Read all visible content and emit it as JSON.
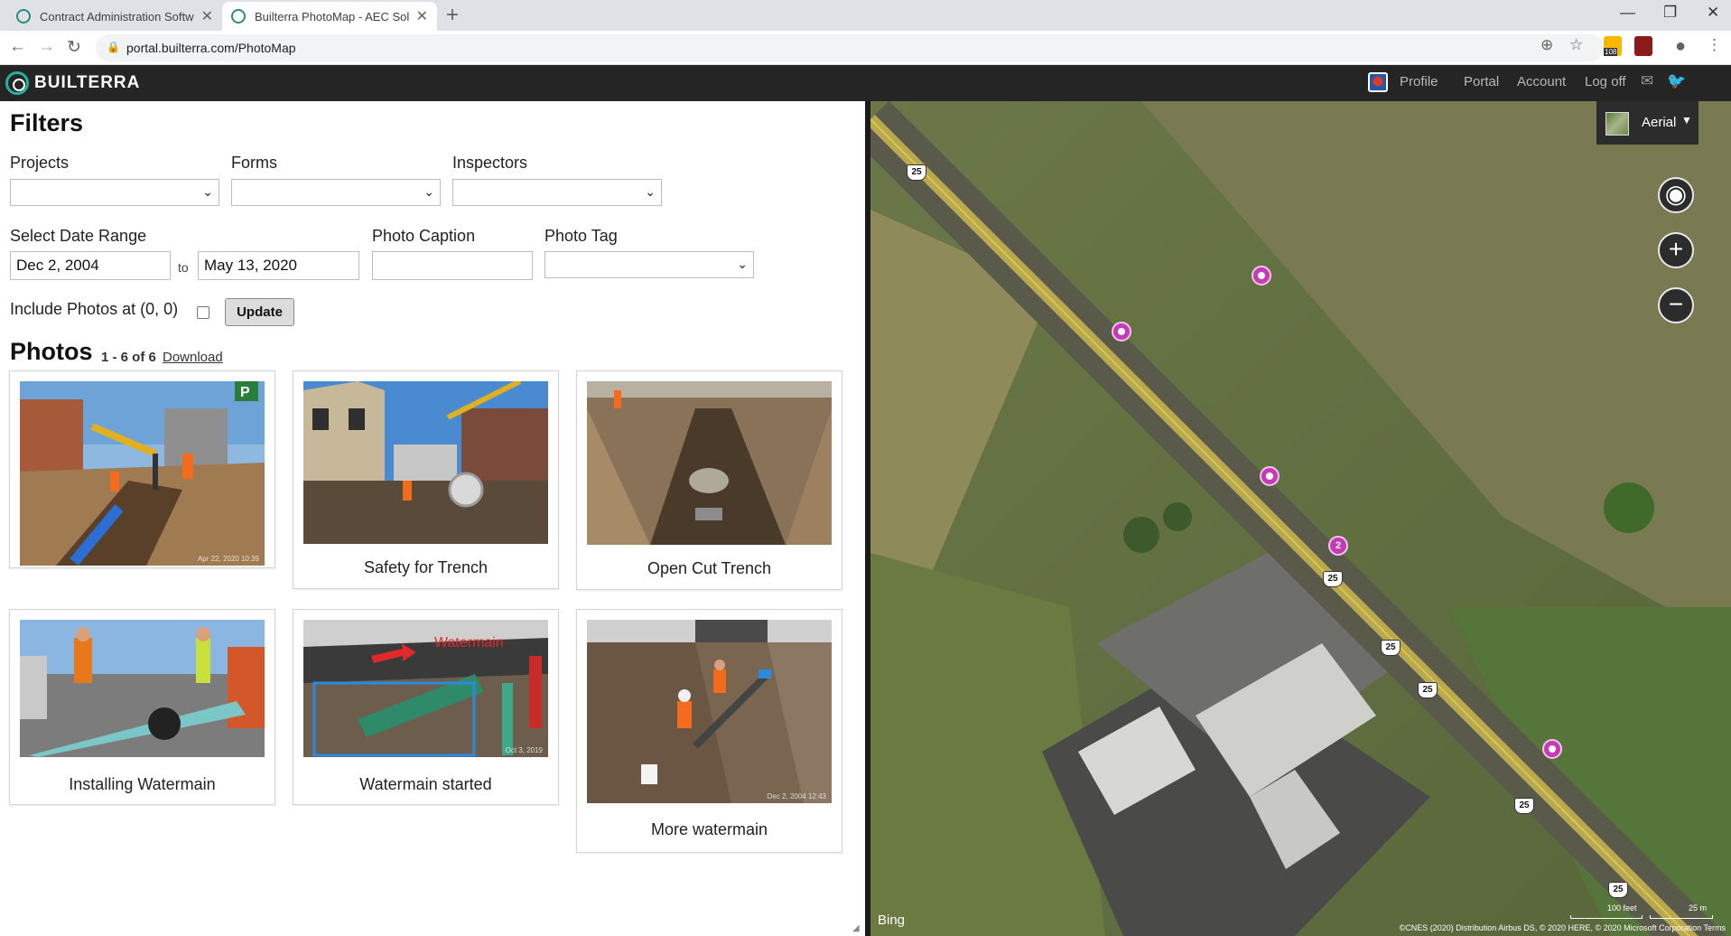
{
  "browser": {
    "tabs": [
      {
        "title": "Contract Administration Software"
      },
      {
        "title": "Builterra PhotoMap - AEC Solutio"
      }
    ],
    "url": "portal.builterra.com/PhotoMap",
    "extension_badge": "108"
  },
  "header": {
    "brand": "BUILTERRA",
    "nav": {
      "profile": "Profile",
      "portal": "Portal",
      "account": "Account",
      "logoff": "Log off"
    }
  },
  "filters": {
    "title": "Filters",
    "projects_label": "Projects",
    "forms_label": "Forms",
    "inspectors_label": "Inspectors",
    "date_range_label": "Select Date Range",
    "date_from": "Dec 2, 2004",
    "to_text": "to",
    "date_to": "May 13, 2020",
    "caption_label": "Photo Caption",
    "tag_label": "Photo Tag",
    "include_zero_label": "Include Photos at (0, 0)",
    "update_button": "Update"
  },
  "photos": {
    "title": "Photos",
    "count": "1 - 6 of 6",
    "download": "Download",
    "items": [
      {
        "caption": "",
        "stamp": "Apr 22, 2020 10:39"
      },
      {
        "caption": "Safety for Trench",
        "stamp": ""
      },
      {
        "caption": "Open Cut Trench",
        "stamp": ""
      },
      {
        "caption": "Installing Watermain",
        "stamp": ""
      },
      {
        "caption": "Watermain started",
        "stamp": "Oct 3, 2019",
        "overlay_text": "Watermain"
      },
      {
        "caption": "More watermain",
        "stamp": "Dec 2, 2004 12:43"
      }
    ]
  },
  "map": {
    "layer": "Aerial",
    "cluster_count": "2",
    "road_shield": "25",
    "attribution": "Bing",
    "scale_feet": "100 feet",
    "scale_meters": "25 m",
    "copyright": "©CNES (2020) Distribution Airbus DS, © 2020 HERE, © 2020 Microsoft Corporation   Terms"
  }
}
